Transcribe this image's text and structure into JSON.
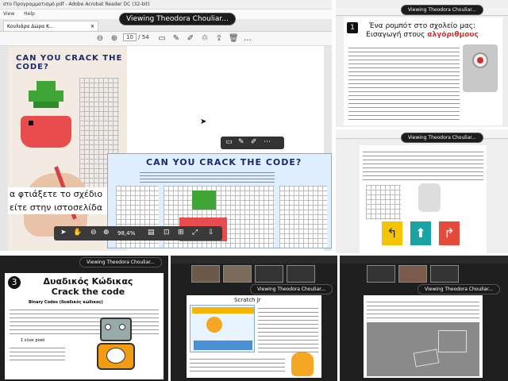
{
  "main": {
    "window_title": "στο Προγραμματισμό.pdf - Adobe Acrobat Reader DC (32-bit)",
    "menu": [
      "View",
      "Help"
    ],
    "tab_label": "Κουλιάρα Δώρα Κ...",
    "page_current": "10",
    "page_total": "/ 54",
    "zoom": "98,4%",
    "doc_title_left": "CAN YOU CRACK THE CODE?",
    "doc_title_right": "CAN YOU CRACK THE CODE?",
    "greek_line1": "α φτιάξετε το σχέδιο",
    "greek_line2": "είτε στην ιστοσελίδα"
  },
  "banners": {
    "main": "Viewing Theodora Chouliar...",
    "right_top": "Viewing Theodora Chouliar...",
    "right_mid": "Viewing Theodora Chouliar...",
    "bottom_left": "Viewing Theodora Chouliar...",
    "bottom_mid": "Viewing Theodora Chouliar...",
    "bottom_right": "Viewing Theodora Chouliar..."
  },
  "slide_right_top": {
    "number": "1",
    "title_line1": "Ένα ρομπότ στο σχολείο μας:",
    "title_line2": "Εισαγωγή στους",
    "title_highlight": "αλγόριθμους"
  },
  "slide_bottom_left": {
    "number": "3",
    "title_line1": "Δυαδικός Κώδικας",
    "title_line2": "Crack the code",
    "bullet1": "Binary Codes (δυαδικός κώδικας)",
    "bullet2": "1 είναι pixel"
  },
  "slide_bottom_mid": {
    "title": "Scratch Jr"
  },
  "colors": {
    "banner_bg": "#1b1b1b",
    "slide_title_color": "#111111",
    "highlight_red": "#d32f2f",
    "robot_orange": "#f39c12",
    "dark_bg": "#1f1f1f"
  }
}
